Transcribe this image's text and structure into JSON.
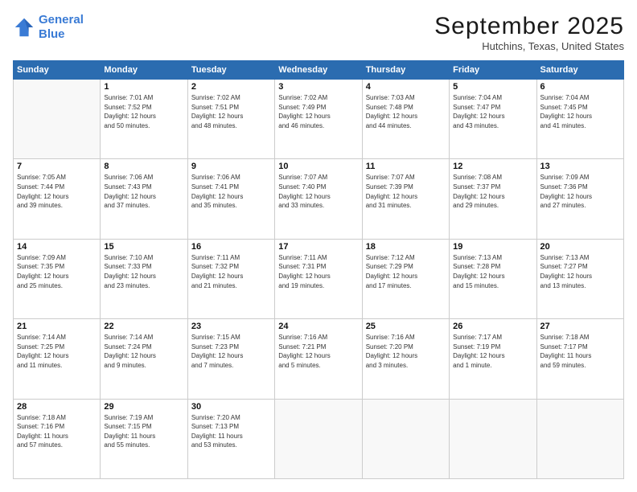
{
  "logo": {
    "line1": "General",
    "line2": "Blue"
  },
  "title": "September 2025",
  "location": "Hutchins, Texas, United States",
  "days_header": [
    "Sunday",
    "Monday",
    "Tuesday",
    "Wednesday",
    "Thursday",
    "Friday",
    "Saturday"
  ],
  "weeks": [
    [
      {
        "day": "",
        "info": ""
      },
      {
        "day": "1",
        "info": "Sunrise: 7:01 AM\nSunset: 7:52 PM\nDaylight: 12 hours\nand 50 minutes."
      },
      {
        "day": "2",
        "info": "Sunrise: 7:02 AM\nSunset: 7:51 PM\nDaylight: 12 hours\nand 48 minutes."
      },
      {
        "day": "3",
        "info": "Sunrise: 7:02 AM\nSunset: 7:49 PM\nDaylight: 12 hours\nand 46 minutes."
      },
      {
        "day": "4",
        "info": "Sunrise: 7:03 AM\nSunset: 7:48 PM\nDaylight: 12 hours\nand 44 minutes."
      },
      {
        "day": "5",
        "info": "Sunrise: 7:04 AM\nSunset: 7:47 PM\nDaylight: 12 hours\nand 43 minutes."
      },
      {
        "day": "6",
        "info": "Sunrise: 7:04 AM\nSunset: 7:45 PM\nDaylight: 12 hours\nand 41 minutes."
      }
    ],
    [
      {
        "day": "7",
        "info": "Sunrise: 7:05 AM\nSunset: 7:44 PM\nDaylight: 12 hours\nand 39 minutes."
      },
      {
        "day": "8",
        "info": "Sunrise: 7:06 AM\nSunset: 7:43 PM\nDaylight: 12 hours\nand 37 minutes."
      },
      {
        "day": "9",
        "info": "Sunrise: 7:06 AM\nSunset: 7:41 PM\nDaylight: 12 hours\nand 35 minutes."
      },
      {
        "day": "10",
        "info": "Sunrise: 7:07 AM\nSunset: 7:40 PM\nDaylight: 12 hours\nand 33 minutes."
      },
      {
        "day": "11",
        "info": "Sunrise: 7:07 AM\nSunset: 7:39 PM\nDaylight: 12 hours\nand 31 minutes."
      },
      {
        "day": "12",
        "info": "Sunrise: 7:08 AM\nSunset: 7:37 PM\nDaylight: 12 hours\nand 29 minutes."
      },
      {
        "day": "13",
        "info": "Sunrise: 7:09 AM\nSunset: 7:36 PM\nDaylight: 12 hours\nand 27 minutes."
      }
    ],
    [
      {
        "day": "14",
        "info": "Sunrise: 7:09 AM\nSunset: 7:35 PM\nDaylight: 12 hours\nand 25 minutes."
      },
      {
        "day": "15",
        "info": "Sunrise: 7:10 AM\nSunset: 7:33 PM\nDaylight: 12 hours\nand 23 minutes."
      },
      {
        "day": "16",
        "info": "Sunrise: 7:11 AM\nSunset: 7:32 PM\nDaylight: 12 hours\nand 21 minutes."
      },
      {
        "day": "17",
        "info": "Sunrise: 7:11 AM\nSunset: 7:31 PM\nDaylight: 12 hours\nand 19 minutes."
      },
      {
        "day": "18",
        "info": "Sunrise: 7:12 AM\nSunset: 7:29 PM\nDaylight: 12 hours\nand 17 minutes."
      },
      {
        "day": "19",
        "info": "Sunrise: 7:13 AM\nSunset: 7:28 PM\nDaylight: 12 hours\nand 15 minutes."
      },
      {
        "day": "20",
        "info": "Sunrise: 7:13 AM\nSunset: 7:27 PM\nDaylight: 12 hours\nand 13 minutes."
      }
    ],
    [
      {
        "day": "21",
        "info": "Sunrise: 7:14 AM\nSunset: 7:25 PM\nDaylight: 12 hours\nand 11 minutes."
      },
      {
        "day": "22",
        "info": "Sunrise: 7:14 AM\nSunset: 7:24 PM\nDaylight: 12 hours\nand 9 minutes."
      },
      {
        "day": "23",
        "info": "Sunrise: 7:15 AM\nSunset: 7:23 PM\nDaylight: 12 hours\nand 7 minutes."
      },
      {
        "day": "24",
        "info": "Sunrise: 7:16 AM\nSunset: 7:21 PM\nDaylight: 12 hours\nand 5 minutes."
      },
      {
        "day": "25",
        "info": "Sunrise: 7:16 AM\nSunset: 7:20 PM\nDaylight: 12 hours\nand 3 minutes."
      },
      {
        "day": "26",
        "info": "Sunrise: 7:17 AM\nSunset: 7:19 PM\nDaylight: 12 hours\nand 1 minute."
      },
      {
        "day": "27",
        "info": "Sunrise: 7:18 AM\nSunset: 7:17 PM\nDaylight: 11 hours\nand 59 minutes."
      }
    ],
    [
      {
        "day": "28",
        "info": "Sunrise: 7:18 AM\nSunset: 7:16 PM\nDaylight: 11 hours\nand 57 minutes."
      },
      {
        "day": "29",
        "info": "Sunrise: 7:19 AM\nSunset: 7:15 PM\nDaylight: 11 hours\nand 55 minutes."
      },
      {
        "day": "30",
        "info": "Sunrise: 7:20 AM\nSunset: 7:13 PM\nDaylight: 11 hours\nand 53 minutes."
      },
      {
        "day": "",
        "info": ""
      },
      {
        "day": "",
        "info": ""
      },
      {
        "day": "",
        "info": ""
      },
      {
        "day": "",
        "info": ""
      }
    ]
  ]
}
